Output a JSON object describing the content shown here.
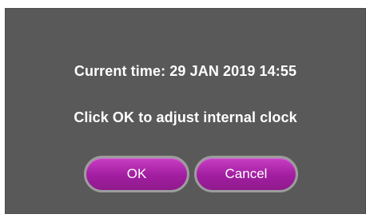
{
  "dialog": {
    "current_time_text": "Current time: 29 JAN 2019 14:55",
    "prompt_text": "Click OK to adjust internal clock",
    "ok_label": "OK",
    "cancel_label": "Cancel"
  },
  "colors": {
    "dialog_background": "#595959",
    "button_accent": "#a21ea0",
    "button_border": "#9c9c9c",
    "text": "#ffffff"
  }
}
